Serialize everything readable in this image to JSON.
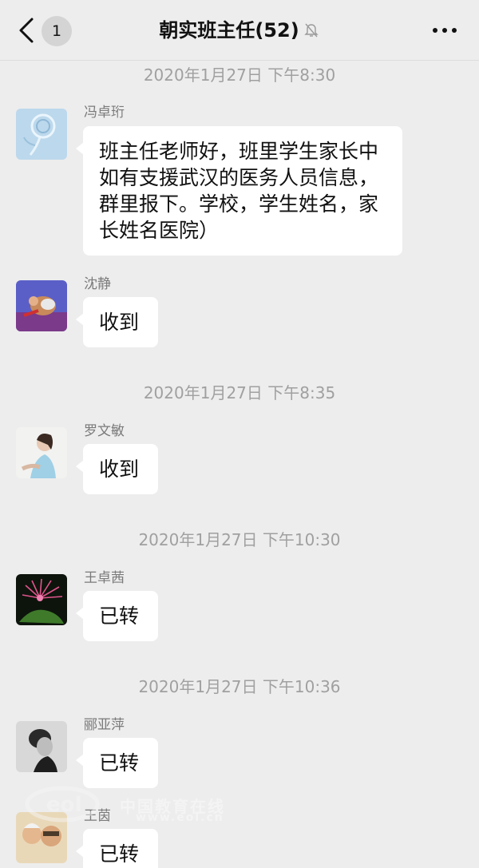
{
  "header": {
    "back_icon": "chevron-left-icon",
    "unread_count": "1",
    "title": "朝实班主任(52)",
    "mute_icon": "bell-mute-icon",
    "more_icon": "more-dots-icon"
  },
  "timestamps": [
    "2020年1月27日 下午8:30",
    "2020年1月27日 下午8:35",
    "2020年1月27日 下午10:30",
    "2020年1月27日 下午10:36"
  ],
  "messages": [
    {
      "sender": "冯卓珩",
      "text": "班主任老师好，班里学生家长中如有支援武汉的医务人员信息，群里报下。学校，学生姓名，家长姓名医院）"
    },
    {
      "sender": "沈静",
      "text": "收到"
    },
    {
      "sender": "罗文敏",
      "text": "收到"
    },
    {
      "sender": "王卓茜",
      "text": "已转"
    },
    {
      "sender": "郦亚萍",
      "text": "已转"
    },
    {
      "sender": "王茵",
      "text": "已转"
    }
  ],
  "watermark": {
    "text": "中国教育在线",
    "url": "www.eol.cn"
  }
}
